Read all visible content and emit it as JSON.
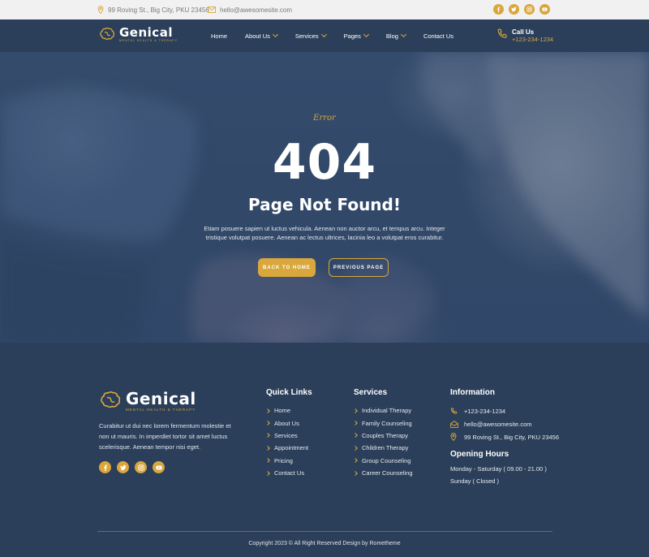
{
  "topbar": {
    "address": "99 Roving St., Big City, PKU 23456",
    "email": "hello@awesomesite.com",
    "socials": [
      "facebook-icon",
      "twitter-icon",
      "instagram-icon",
      "youtube-icon"
    ]
  },
  "nav": {
    "logo_name": "Genical",
    "logo_tag": "Mental Health & Therapy",
    "menu": [
      {
        "label": "Home",
        "dropdown": false
      },
      {
        "label": "About Us",
        "dropdown": true
      },
      {
        "label": "Services",
        "dropdown": true
      },
      {
        "label": "Pages",
        "dropdown": true
      },
      {
        "label": "Blog",
        "dropdown": true
      },
      {
        "label": "Contact Us",
        "dropdown": false
      }
    ],
    "call_label": "Call Us",
    "call_number": "+123-234-1234"
  },
  "hero": {
    "eyebrow": "Error",
    "code": "404",
    "heading": "Page Not Found!",
    "description": "Etiam posuere sapien ut luctus vehicula. Aenean non auctor arcu, et tempus arcu. Integer tristique volutpat posuere. Aenean ac lectus ultrices, lacinia leo a volutpat eros curabitur.",
    "btn_home": "Back to Home",
    "btn_prev": "Previous Page"
  },
  "footer": {
    "logo_name": "Genical",
    "logo_tag": "Mental Health & Therapy",
    "about": "Curabitur ut dui nec lorem fermentum molestie  et non ut mauris. In imperdiet tortor sit amet luctus scelerisque. Aenean tempor nisi eget.",
    "quick_links_title": "Quick Links",
    "quick_links": [
      "Home",
      "About Us",
      "Services",
      "Appointment",
      "Pricing",
      "Contact Us"
    ],
    "services_title": "Services",
    "services": [
      "Individual Therapy",
      "Family Counseling",
      "Couples Therapy",
      "Children Therapy",
      "Group Counseling",
      "Career Counseling"
    ],
    "info_title": "Information",
    "info": {
      "phone": "+123-234-1234",
      "email": "hello@awesomesite.com",
      "address": "99 Roving St., Big City, PKU 23456"
    },
    "hours_title": "Opening Hours",
    "hours": [
      "Monday - Saturday ( 09.00 - 21.00 )",
      "Sunday ( Closed )"
    ],
    "copyright": "Copyright 2023 © All Right Reserved Design by Rometheme"
  },
  "colors": {
    "accent": "#d9a73c",
    "navy": "#2b3f5a"
  }
}
